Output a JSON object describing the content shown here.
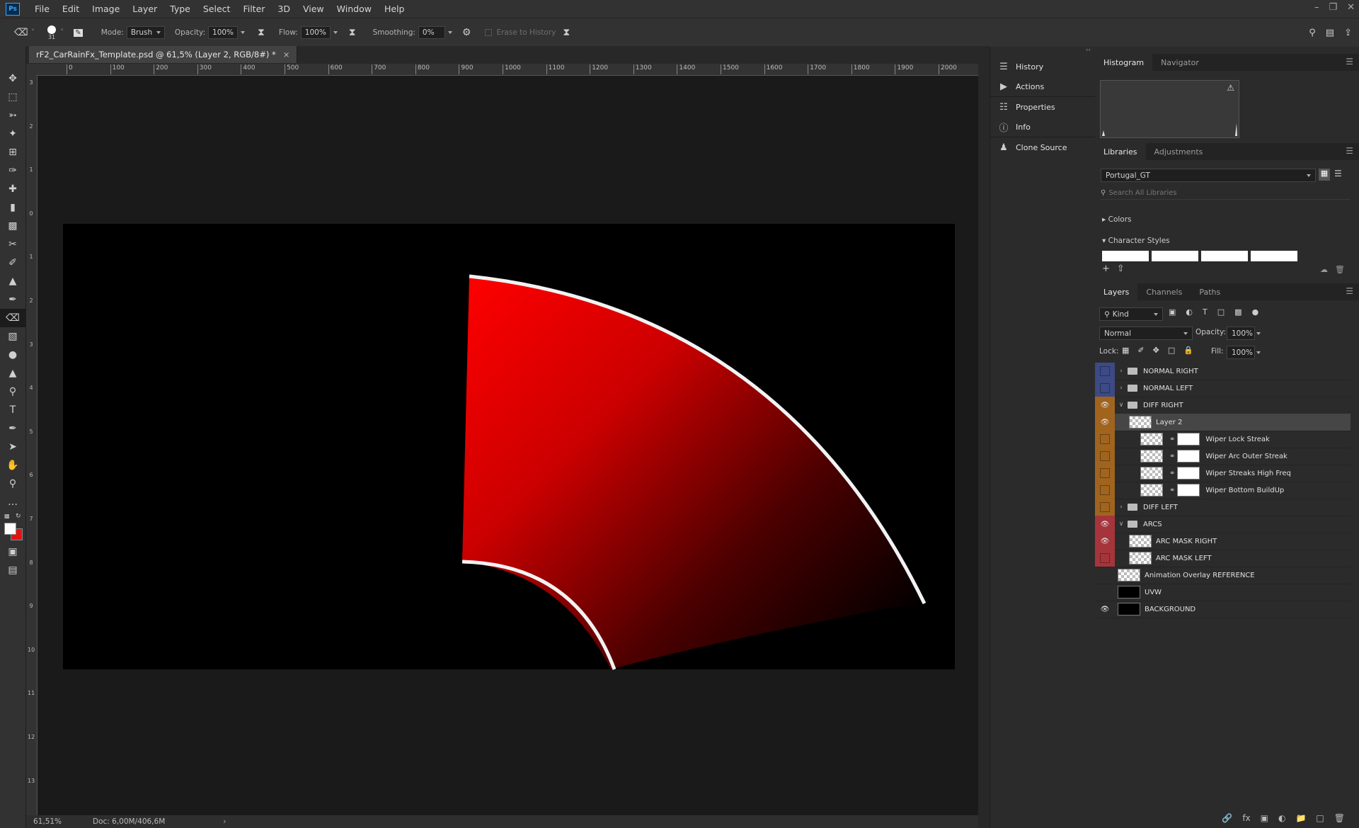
{
  "app": {
    "logo": "Ps"
  },
  "menu": [
    "File",
    "Edit",
    "Image",
    "Layer",
    "Type",
    "Select",
    "Filter",
    "3D",
    "View",
    "Window",
    "Help"
  ],
  "options": {
    "brush_size": "31",
    "mode_label": "Mode:",
    "mode_value": "Brush",
    "opacity_label": "Opacity:",
    "opacity_value": "100%",
    "flow_label": "Flow:",
    "flow_value": "100%",
    "smoothing_label": "Smoothing:",
    "smoothing_value": "0%",
    "erase_history": "Erase to History"
  },
  "document": {
    "tab_title": "rF2_CarRainFx_Template.psd @ 61,5% (Layer 2, RGB/8#) *",
    "close": "×"
  },
  "ruler": {
    "top_labels": [
      "0",
      "100",
      "200",
      "300",
      "400",
      "500",
      "600",
      "700",
      "800",
      "900",
      "1000",
      "1100",
      "1200",
      "1300",
      "1400",
      "1500",
      "1600",
      "1700",
      "1800",
      "1900",
      "2000"
    ],
    "left_labels": [
      "3",
      "2",
      "1",
      "0",
      "1",
      "2",
      "3",
      "4",
      "5",
      "6",
      "7",
      "8",
      "9",
      "10",
      "11",
      "12",
      "13"
    ]
  },
  "status": {
    "zoom": "61,51%",
    "doc": "Doc: 6,00M/406,6M"
  },
  "dock": {
    "history": "History",
    "actions": "Actions",
    "properties": "Properties",
    "info": "Info",
    "clone_source": "Clone Source"
  },
  "histogram": {
    "tabs": [
      "Histogram",
      "Navigator"
    ]
  },
  "libraries": {
    "tabs": [
      "Libraries",
      "Adjustments"
    ],
    "library_name": "Portugal_GT",
    "search_placeholder": "Search All Libraries",
    "colors": "Colors",
    "char_styles": "Character Styles"
  },
  "layers_panel": {
    "tabs": [
      "Layers",
      "Channels",
      "Paths"
    ],
    "kind": "Kind",
    "blend": "Normal",
    "opacity_label": "Opacity:",
    "opacity_value": "100%",
    "lock_label": "Lock:",
    "fill_label": "Fill:",
    "fill_value": "100%",
    "layers": [
      {
        "name": "NORMAL RIGHT",
        "type": "group",
        "expanded": false,
        "color": "blue",
        "visible": false,
        "indent": 0
      },
      {
        "name": "NORMAL LEFT",
        "type": "group",
        "expanded": false,
        "color": "blue",
        "visible": false,
        "indent": 0
      },
      {
        "name": "DIFF RIGHT",
        "type": "group",
        "expanded": true,
        "color": "orange",
        "visible": true,
        "indent": 0
      },
      {
        "name": "Layer 2",
        "type": "layer",
        "color": "orange",
        "visible": true,
        "indent": 1,
        "selected": true
      },
      {
        "name": "Wiper Lock Streak",
        "type": "masked",
        "color": "orange",
        "visible": false,
        "indent": 2
      },
      {
        "name": "Wiper Arc Outer Streak",
        "type": "masked",
        "color": "orange",
        "visible": false,
        "indent": 2
      },
      {
        "name": "Wiper Streaks High Freq",
        "type": "masked",
        "color": "orange",
        "visible": false,
        "indent": 2
      },
      {
        "name": "Wiper Bottom BuildUp",
        "type": "masked",
        "color": "orange",
        "visible": false,
        "indent": 2
      },
      {
        "name": "DIFF LEFT",
        "type": "group",
        "expanded": false,
        "color": "orange",
        "visible": false,
        "indent": 0
      },
      {
        "name": "ARCS",
        "type": "group",
        "expanded": true,
        "color": "red",
        "visible": true,
        "indent": 0
      },
      {
        "name": "ARC MASK RIGHT",
        "type": "layer",
        "color": "red",
        "visible": true,
        "indent": 1
      },
      {
        "name": "ARC MASK LEFT",
        "type": "layer",
        "color": "red",
        "visible": false,
        "indent": 1
      },
      {
        "name": "Animation Overlay REFERENCE",
        "type": "layer",
        "color": "none",
        "visible": false,
        "indent": 0
      },
      {
        "name": "UVW",
        "type": "layer",
        "color": "none",
        "visible": false,
        "indent": 0
      },
      {
        "name": "BACKGROUND",
        "type": "layer",
        "color": "none",
        "visible": true,
        "indent": 0
      }
    ]
  },
  "colors": {
    "fg": "#ffffff",
    "bg": "#e31212",
    "canvas_red": "#ff0000"
  }
}
